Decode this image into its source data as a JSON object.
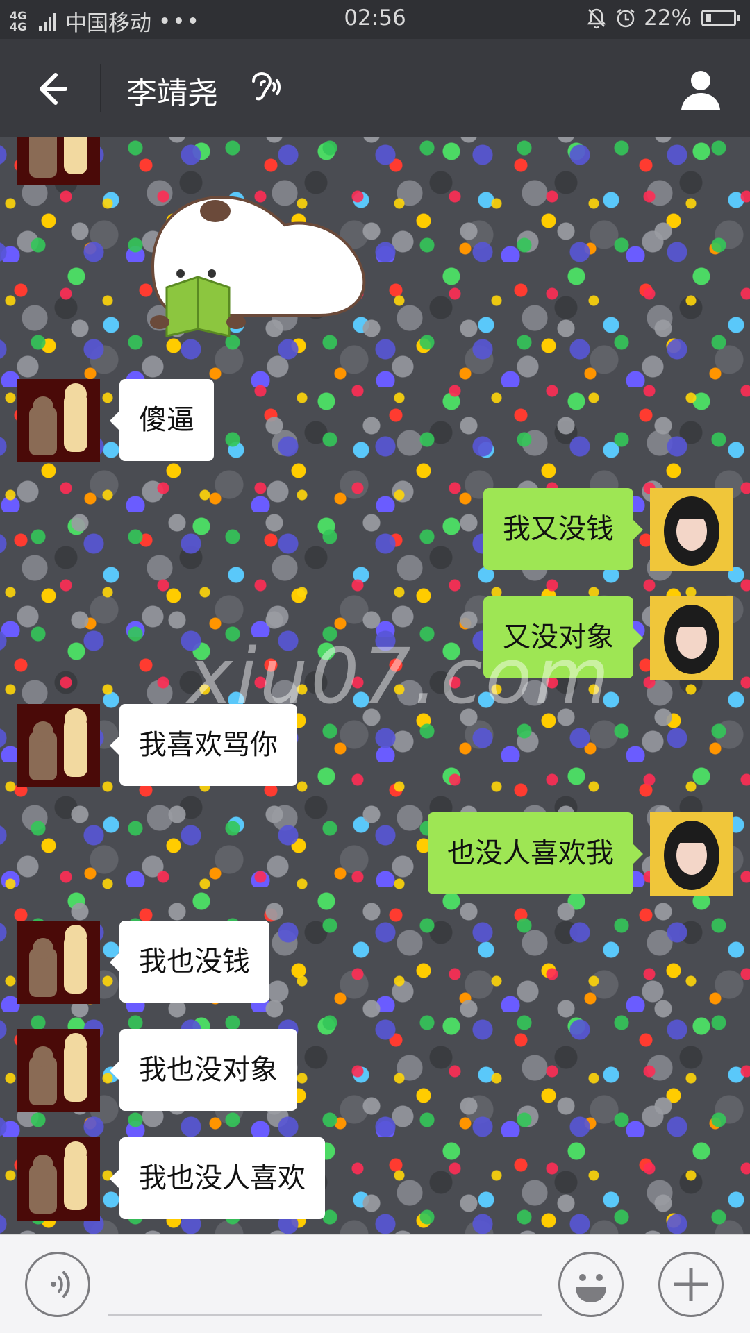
{
  "status_bar": {
    "network": "4G 4G",
    "carrier": "中国移动",
    "more": "•••",
    "time": "02:56",
    "battery_percent": "22%",
    "battery_level": 0.22,
    "icons": [
      "signal-icon",
      "notification-bell-icon",
      "alarm-clock-icon",
      "battery-icon"
    ]
  },
  "nav": {
    "title": "李靖尧",
    "back_icon": "back-arrow-icon",
    "ear_icon": "earpiece-mode-icon",
    "profile_icon": "person-profile-icon"
  },
  "chat": {
    "watermark": "xiu07.com",
    "sticker": "panda-reading-book-sticker",
    "messages": [
      {
        "side": "left",
        "text": "傻逼"
      },
      {
        "side": "right",
        "text": "我又没钱"
      },
      {
        "side": "right",
        "text": "又没对象"
      },
      {
        "side": "left",
        "text": "我喜欢骂你"
      },
      {
        "side": "right",
        "text": "也没人喜欢我"
      },
      {
        "side": "left",
        "text": "我也没钱"
      },
      {
        "side": "left",
        "text": "我也没对象"
      },
      {
        "side": "left",
        "text": "我也没人喜欢"
      }
    ]
  },
  "input_bar": {
    "placeholder": "",
    "voice_icon": "voice-input-icon",
    "emoji_icon": "emoji-smile-icon",
    "plus_icon": "plus-more-icon"
  },
  "colors": {
    "nav_bg": "#393a3f",
    "status_bg": "#2f3034",
    "bubble_sent": "#9ee654",
    "bubble_received": "#ffffff",
    "input_bar_bg": "#f4f4f6"
  }
}
